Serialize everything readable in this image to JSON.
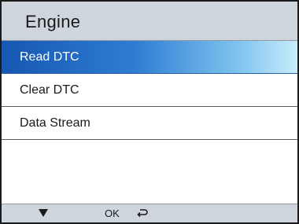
{
  "header": {
    "title": "Engine"
  },
  "menu": {
    "items": [
      {
        "label": "Read DTC",
        "selected": true
      },
      {
        "label": "Clear DTC",
        "selected": false
      },
      {
        "label": "Data Stream",
        "selected": false
      }
    ]
  },
  "footer": {
    "down_icon": "down-triangle-icon",
    "ok_label": "OK",
    "back_icon": "return-arrow-icon"
  },
  "colors": {
    "selection_start": "#1657b4",
    "selection_end": "#c8ecfb",
    "bar_background": "#cfd5dc"
  }
}
